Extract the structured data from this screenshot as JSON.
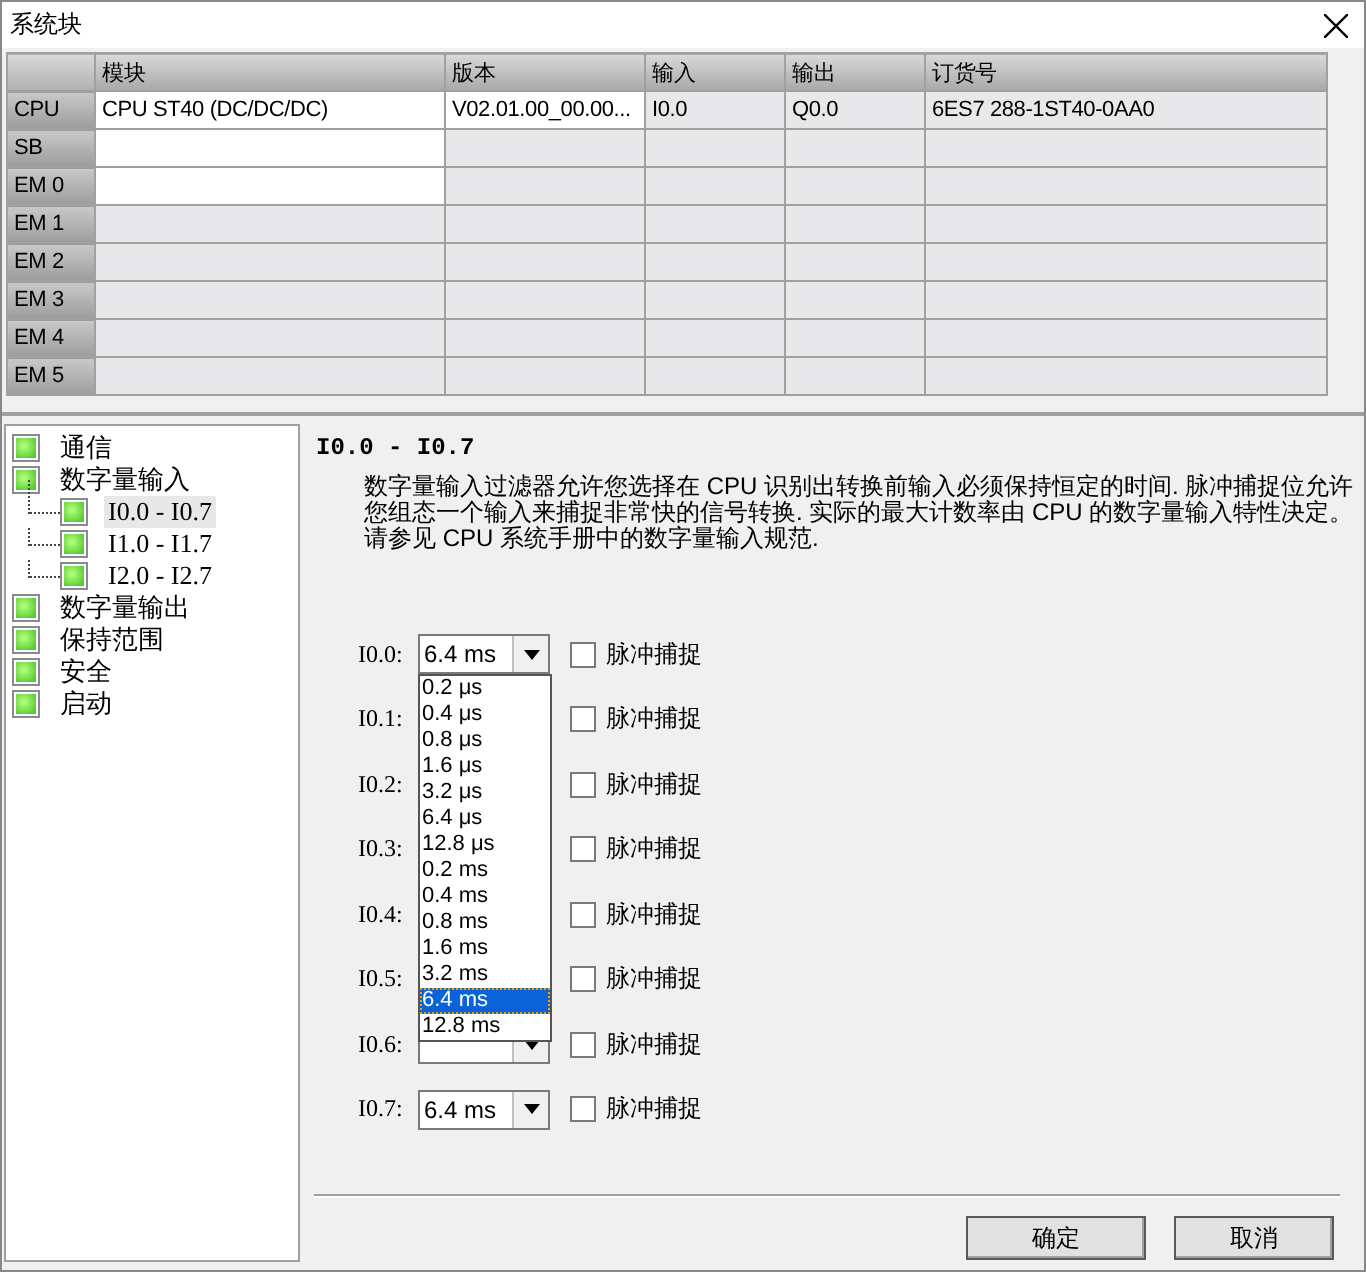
{
  "window": {
    "title": "系统块"
  },
  "table": {
    "columns": [
      "模块",
      "版本",
      "输入",
      "输出",
      "订货号"
    ],
    "rows": [
      {
        "header": "CPU",
        "cells": [
          {
            "text": "CPU ST40 (DC/DC/DC)",
            "enabled": true
          },
          {
            "text": "V02.01.00_00.00...",
            "enabled": true
          },
          {
            "text": "I0.0",
            "enabled": false
          },
          {
            "text": "Q0.0",
            "enabled": false
          },
          {
            "text": "6ES7 288-1ST40-0AA0",
            "enabled": false
          }
        ]
      },
      {
        "header": "SB",
        "cells": [
          {
            "enabled": true
          },
          {
            "enabled": false
          },
          {
            "enabled": false
          },
          {
            "enabled": false
          },
          {
            "enabled": false
          }
        ]
      },
      {
        "header": "EM 0",
        "cells": [
          {
            "enabled": true
          },
          {
            "enabled": false
          },
          {
            "enabled": false
          },
          {
            "enabled": false
          },
          {
            "enabled": false
          }
        ]
      },
      {
        "header": "EM 1",
        "cells": [
          {
            "enabled": false
          },
          {
            "enabled": false
          },
          {
            "enabled": false
          },
          {
            "enabled": false
          },
          {
            "enabled": false
          }
        ]
      },
      {
        "header": "EM 2",
        "cells": [
          {
            "enabled": false
          },
          {
            "enabled": false
          },
          {
            "enabled": false
          },
          {
            "enabled": false
          },
          {
            "enabled": false
          }
        ]
      },
      {
        "header": "EM 3",
        "cells": [
          {
            "enabled": false
          },
          {
            "enabled": false
          },
          {
            "enabled": false
          },
          {
            "enabled": false
          },
          {
            "enabled": false
          }
        ]
      },
      {
        "header": "EM 4",
        "cells": [
          {
            "enabled": false
          },
          {
            "enabled": false
          },
          {
            "enabled": false
          },
          {
            "enabled": false
          },
          {
            "enabled": false
          }
        ]
      },
      {
        "header": "EM 5",
        "cells": [
          {
            "enabled": false
          },
          {
            "enabled": false
          },
          {
            "enabled": false
          },
          {
            "enabled": false
          },
          {
            "enabled": false
          }
        ]
      }
    ]
  },
  "tree": [
    {
      "label": "通信",
      "selected": false
    },
    {
      "label": "数字量输入",
      "selected": false,
      "children": [
        {
          "label": "I0.0 - I0.7",
          "selected": true
        },
        {
          "label": "I1.0 - I1.7",
          "selected": false
        },
        {
          "label": "I2.0 - I2.7",
          "selected": false
        }
      ]
    },
    {
      "label": "数字量输出",
      "selected": false
    },
    {
      "label": "保持范围",
      "selected": false
    },
    {
      "label": "安全",
      "selected": false
    },
    {
      "label": "启动",
      "selected": false
    }
  ],
  "panel": {
    "heading": "I0.0 - I0.7",
    "description_lines": [
      "数字量输入过滤器允许您选择在 CPU 识别出转换前输入必须保持恒定的时间. 脉冲捕捉位允许",
      "您组态一个输入来捕捉非常快的信号转换. 实际的最大计数率由 CPU 的数字量输入特性决定。",
      "请参见 CPU 系统手册中的数字量输入规范."
    ],
    "inputs": [
      {
        "label": "I0.0:",
        "value": "6.4 ms",
        "pulse_catch": {
          "label": "脉冲捕捉",
          "checked": false
        }
      },
      {
        "label": "I0.1:",
        "pulse_catch": {
          "label": "脉冲捕捉",
          "checked": false
        }
      },
      {
        "label": "I0.2:",
        "pulse_catch": {
          "label": "脉冲捕捉",
          "checked": false
        }
      },
      {
        "label": "I0.3:",
        "pulse_catch": {
          "label": "脉冲捕捉",
          "checked": false
        }
      },
      {
        "label": "I0.4:",
        "pulse_catch": {
          "label": "脉冲捕捉",
          "checked": false
        }
      },
      {
        "label": "I0.5:",
        "pulse_catch": {
          "label": "脉冲捕捉",
          "checked": false
        }
      },
      {
        "label": "I0.6:",
        "combo": true,
        "pulse_catch": {
          "label": "脉冲捕捉",
          "checked": false
        }
      },
      {
        "label": "I0.7:",
        "value": "6.4 ms",
        "pulse_catch": {
          "label": "脉冲捕捉",
          "checked": false
        }
      }
    ],
    "dropdown": {
      "options": [
        {
          "label": "0.2 μs",
          "selected": false
        },
        {
          "label": "0.4 μs",
          "selected": false
        },
        {
          "label": "0.8 μs",
          "selected": false
        },
        {
          "label": "1.6 μs",
          "selected": false
        },
        {
          "label": "3.2 μs",
          "selected": false
        },
        {
          "label": "6.4 μs",
          "selected": false
        },
        {
          "label": "12.8 μs",
          "selected": false
        },
        {
          "label": "0.2 ms",
          "selected": false
        },
        {
          "label": "0.4 ms",
          "selected": false
        },
        {
          "label": "0.8 ms",
          "selected": false
        },
        {
          "label": "1.6 ms",
          "selected": false
        },
        {
          "label": "3.2 ms",
          "selected": false
        },
        {
          "label": "6.4 ms",
          "selected": true
        },
        {
          "label": "12.8 ms",
          "selected": false
        }
      ]
    }
  },
  "buttons": [
    "确定",
    "取消"
  ]
}
